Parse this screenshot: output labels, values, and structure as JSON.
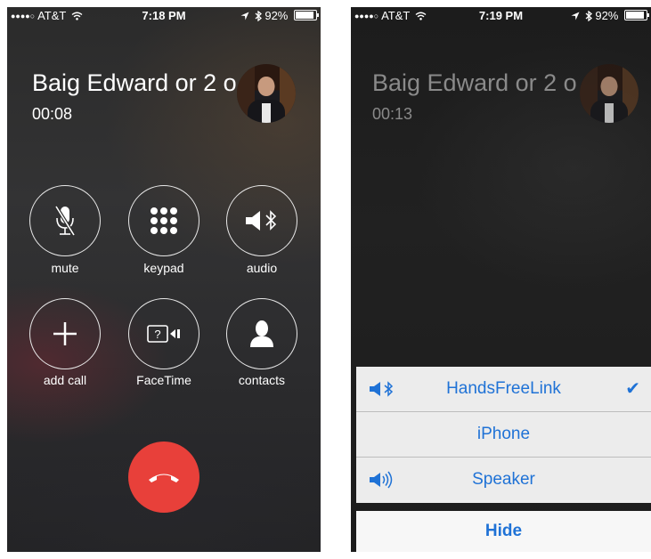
{
  "left_screen": {
    "status": {
      "carrier": "AT&T",
      "time": "7:18 PM",
      "battery": "92%"
    },
    "caller": {
      "name": "Baig Edward or 2 o",
      "timer": "00:08"
    },
    "buttons": [
      {
        "label": "mute"
      },
      {
        "label": "keypad"
      },
      {
        "label": "audio"
      },
      {
        "label": "add call"
      },
      {
        "label": "FaceTime"
      },
      {
        "label": "contacts"
      }
    ],
    "end_call_color": "#e8403a"
  },
  "right_screen": {
    "status": {
      "carrier": "AT&T",
      "time": "7:19 PM",
      "battery": "92%"
    },
    "caller": {
      "name": "Baig Edward or 2 o",
      "timer": "00:13"
    },
    "audio_routes": [
      {
        "label": "HandsFreeLink",
        "icon": "bluetooth-speaker-icon",
        "selected": true
      },
      {
        "label": "iPhone",
        "icon": "",
        "selected": false
      },
      {
        "label": "Speaker",
        "icon": "speaker-icon",
        "selected": false
      }
    ],
    "hide_label": "Hide",
    "accent_color": "#1f72d6"
  }
}
